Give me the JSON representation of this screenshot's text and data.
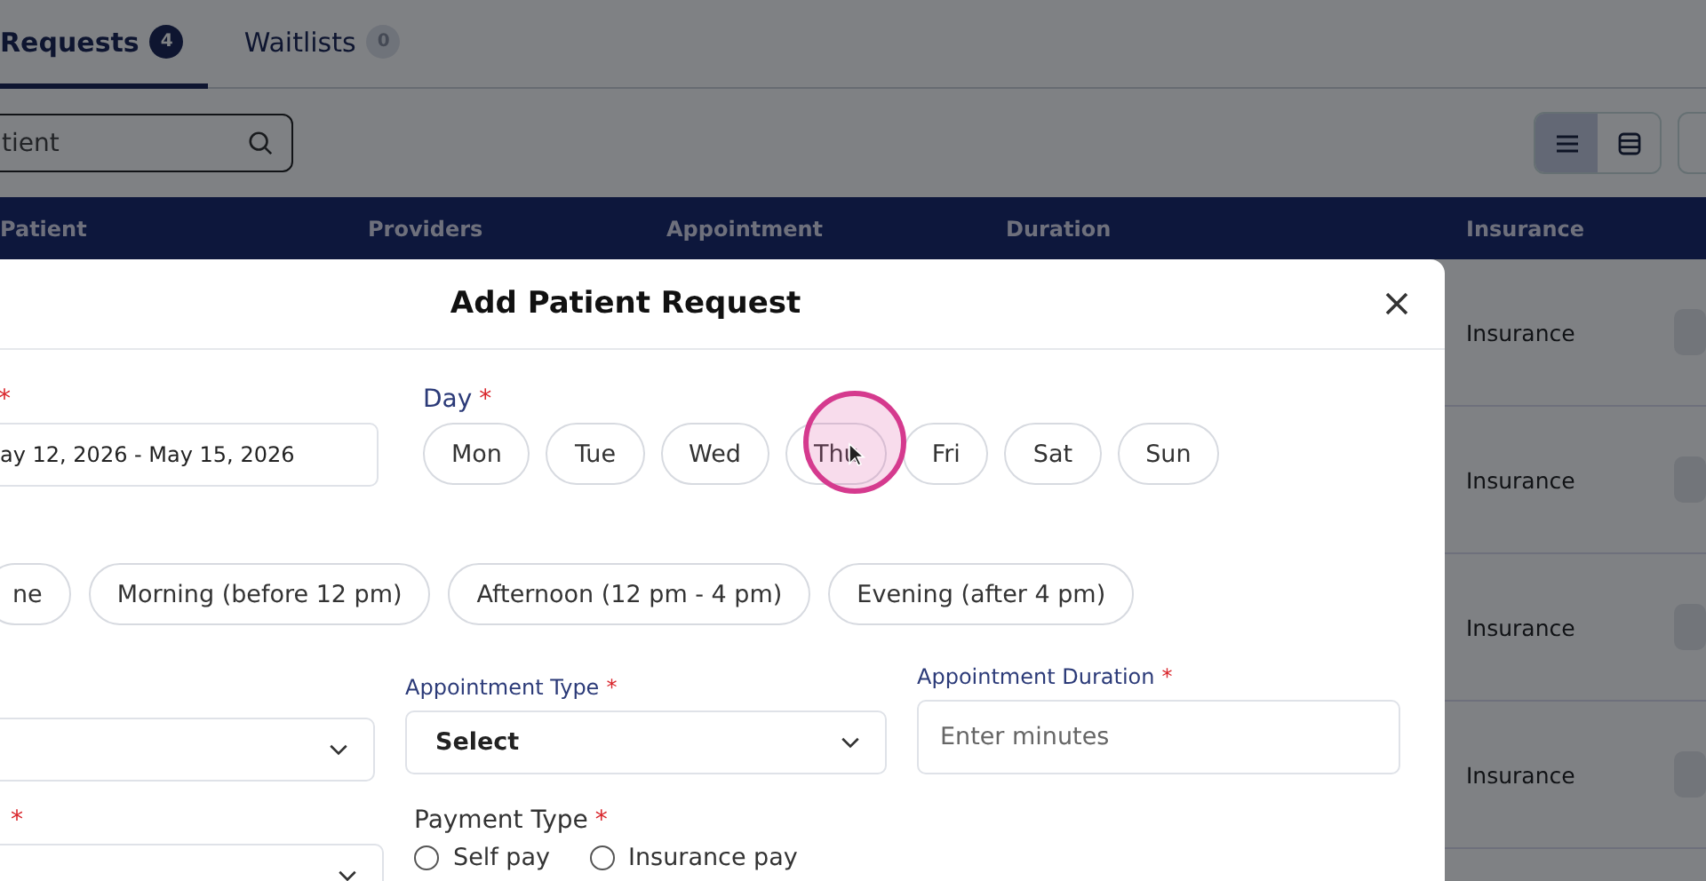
{
  "tabs": [
    {
      "label": "Requests",
      "count": "4",
      "selected": true
    },
    {
      "label": "Waitlists",
      "count": "0",
      "selected": false
    }
  ],
  "search": {
    "value": "tient"
  },
  "view_toggle": [
    {
      "kind": "list",
      "selected": true
    },
    {
      "kind": "table",
      "selected": false
    }
  ],
  "table": {
    "columns": [
      "Patient",
      "Providers",
      "Appointment",
      "Duration",
      "Insurance"
    ],
    "rows": [
      {
        "insurance": "Insurance"
      },
      {
        "insurance": "Insurance"
      },
      {
        "insurance": "Insurance"
      },
      {
        "insurance": "Insurance"
      }
    ]
  },
  "modal": {
    "title": "Add Patient Request",
    "date_field": {
      "required_mark": "*",
      "value": "ay 12, 2026 - May 15, 2026"
    },
    "day_field": {
      "label": "Day",
      "required_mark": "*",
      "days": [
        {
          "label": "Mon",
          "selected": false
        },
        {
          "label": "Tue",
          "selected": false
        },
        {
          "label": "Wed",
          "selected": false
        },
        {
          "label": "Thu",
          "selected": false
        },
        {
          "label": "Fri",
          "selected": false
        },
        {
          "label": "Sat",
          "selected": false
        },
        {
          "label": "Sun",
          "selected": false
        }
      ]
    },
    "time_options": [
      {
        "label": "ne",
        "selected": false
      },
      {
        "label": "Morning (before 12 pm)",
        "selected": false
      },
      {
        "label": "Afternoon (12 pm - 4 pm)",
        "selected": false
      },
      {
        "label": "Evening (after 4 pm)",
        "selected": false
      }
    ],
    "row_fields": [
      {
        "kind": "select"
      },
      {
        "kind": "select",
        "label": "Appointment Type",
        "required_mark": "*",
        "value": "Select"
      },
      {
        "kind": "input",
        "label": "Appointment Duration",
        "required_mark": "*",
        "placeholder": "Enter minutes"
      }
    ],
    "bottom_fields": [
      {
        "kind": "select",
        "required_mark": "*"
      },
      {
        "kind": "radio",
        "label": "Payment Type",
        "required_mark": "*",
        "options": [
          {
            "label": "Self pay",
            "selected": false
          },
          {
            "label": "Insurance pay",
            "selected": false
          }
        ]
      }
    ]
  }
}
